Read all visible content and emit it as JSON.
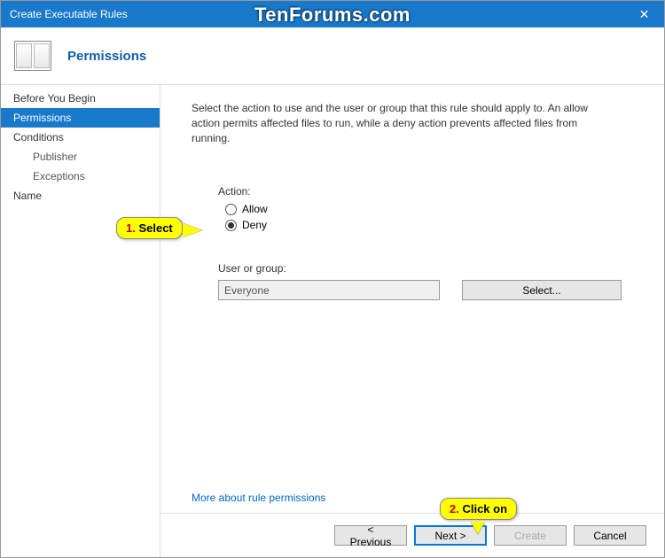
{
  "window": {
    "title": "Create Executable Rules",
    "watermark": "TenForums.com"
  },
  "header": {
    "title": "Permissions"
  },
  "nav": {
    "before": "Before You Begin",
    "permissions": "Permissions",
    "conditions": "Conditions",
    "publisher": "Publisher",
    "exceptions": "Exceptions",
    "name": "Name"
  },
  "content": {
    "description": "Select the action to use and the user or group that this rule should apply to. An allow action permits affected files to run, while a deny action prevents affected files from running.",
    "action_label": "Action:",
    "allow": "Allow",
    "deny": "Deny",
    "group_label": "User or group:",
    "group_value": "Everyone",
    "select_btn": "Select...",
    "link": "More about rule permissions"
  },
  "footer": {
    "previous": "< Previous",
    "next": "Next >",
    "create": "Create",
    "cancel": "Cancel"
  },
  "callouts": {
    "c1_num": "1.",
    "c1_text": " Select",
    "c2_num": "2.",
    "c2_text": " Click on"
  }
}
